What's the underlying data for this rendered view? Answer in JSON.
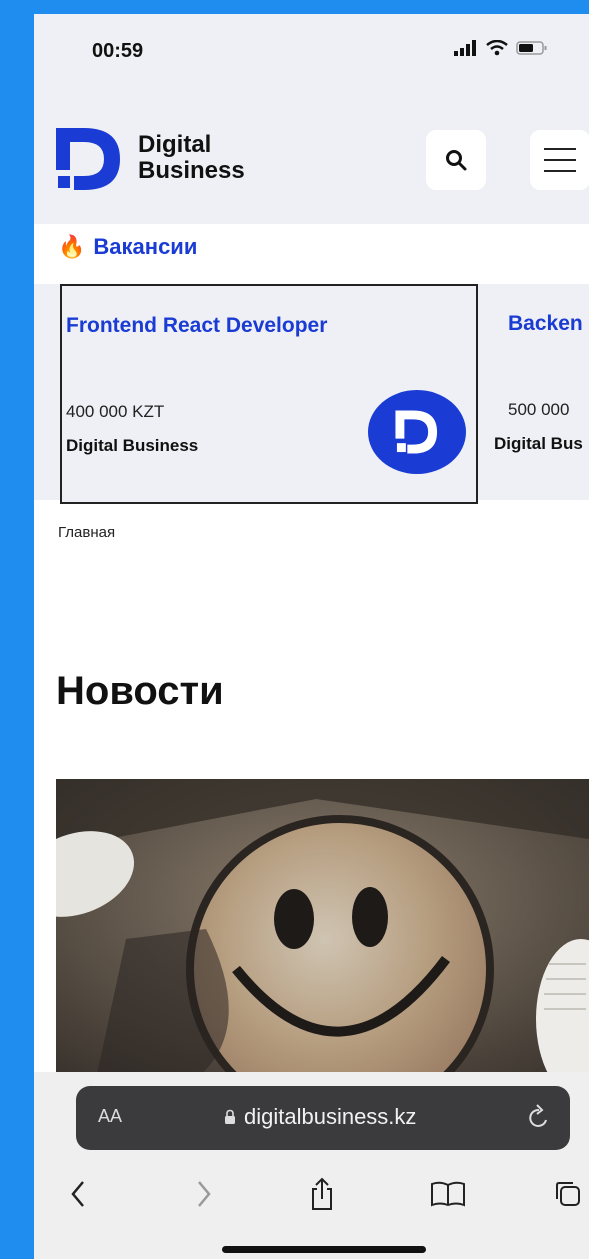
{
  "status_bar": {
    "time": "00:59"
  },
  "header": {
    "logo_line1": "Digital",
    "logo_line2": "Business",
    "search_icon": "search-icon",
    "menu_icon": "hamburger-icon"
  },
  "vacancies": {
    "emoji": "🔥",
    "title": "Вакансии",
    "items": [
      {
        "title": "Frontend React Developer",
        "salary": "400 000 KZT",
        "company": "Digital Business"
      },
      {
        "title": "Backen",
        "salary": "500 000",
        "company": "Digital Bus"
      }
    ]
  },
  "breadcrumb": "Главная",
  "news": {
    "title": "Новости"
  },
  "safari": {
    "aa": "AA",
    "url": "digitalbusiness.kz"
  },
  "colors": {
    "brand": "#1a3bd4",
    "page_bg": "#1f8df0",
    "panel": "#eef0f5"
  }
}
